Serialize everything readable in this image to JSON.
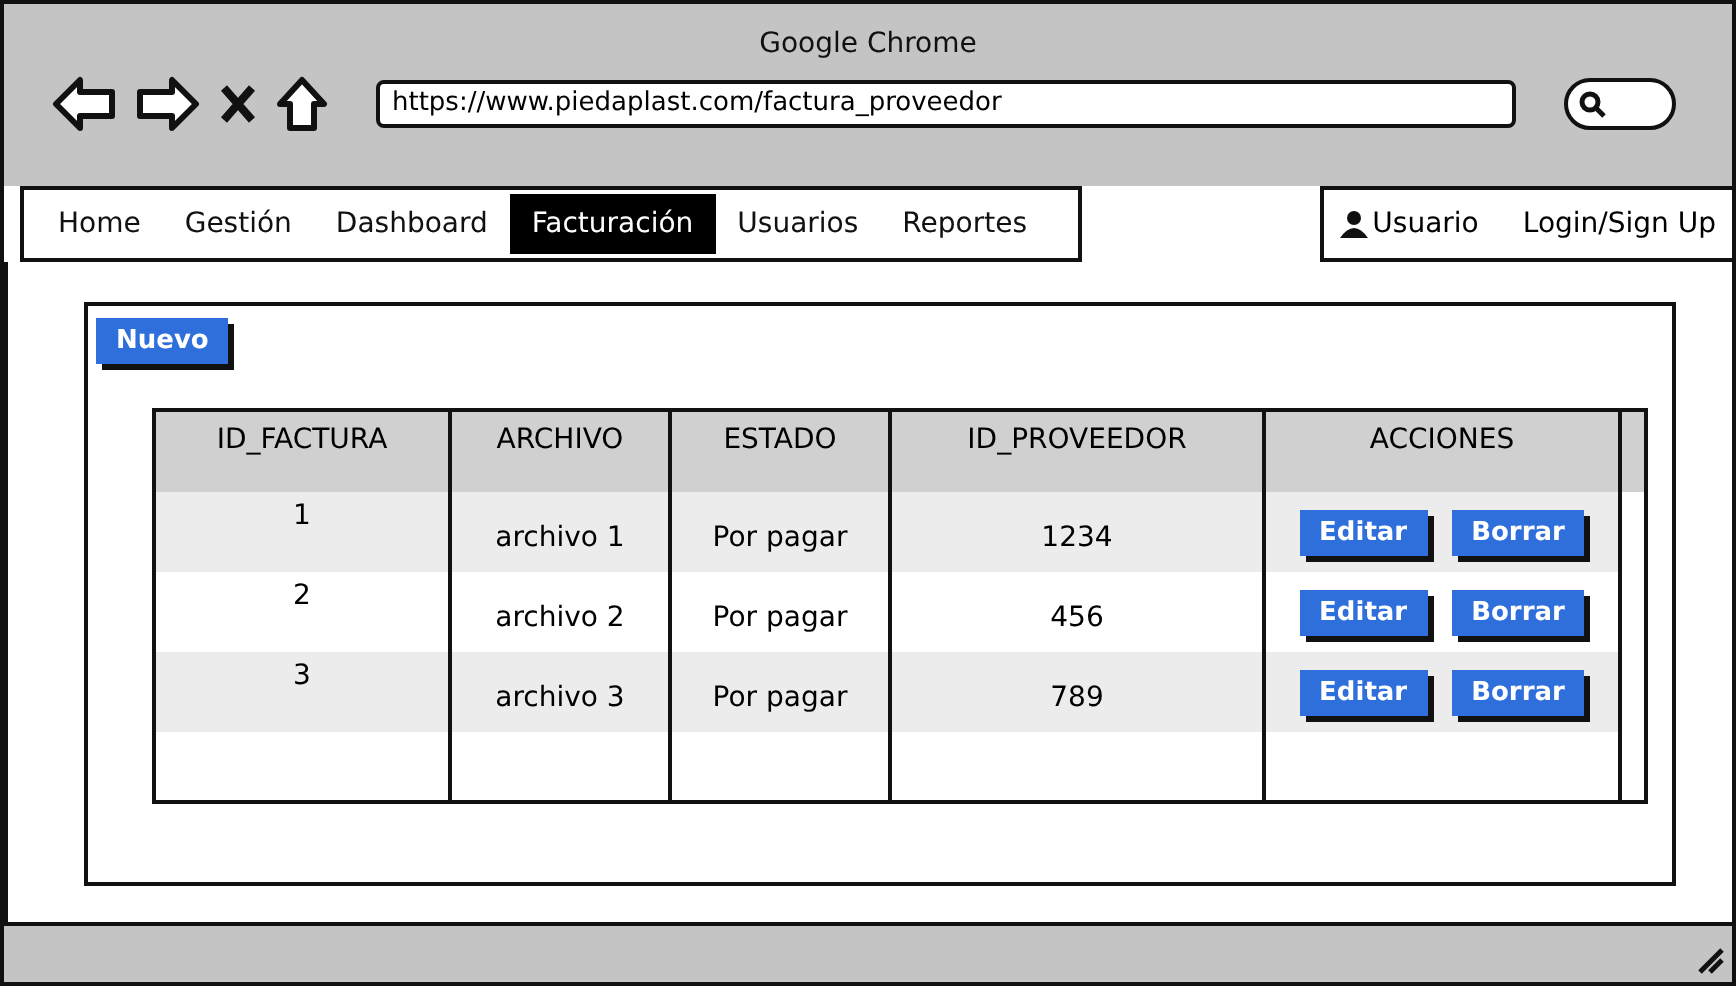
{
  "window": {
    "title": "Google Chrome"
  },
  "address_bar": {
    "value": "https://www.piedaplast.com/factura_proveedor"
  },
  "menu": [
    {
      "label": "Home",
      "selected": false
    },
    {
      "label": "Gestión",
      "selected": false
    },
    {
      "label": "Dashboard",
      "selected": false
    },
    {
      "label": "Facturación",
      "selected": true
    },
    {
      "label": "Usuarios",
      "selected": false
    },
    {
      "label": "Reportes",
      "selected": false
    }
  ],
  "user_menu": {
    "user": "Usuario",
    "login": "Login/Sign Up"
  },
  "new_button": "Nuevo",
  "table": {
    "columns": [
      "ID_FACTURA",
      "ARCHIVO",
      "ESTADO",
      "ID_PROVEEDOR",
      "ACCIONES"
    ],
    "rows": [
      {
        "id": "1",
        "file": "archivo 1",
        "status": "Por pagar",
        "supplier": "1234",
        "actions": [
          "Editar",
          "Borrar"
        ]
      },
      {
        "id": "2",
        "file": "archivo 2",
        "status": "Por pagar",
        "supplier": "456",
        "actions": [
          "Editar",
          "Borrar"
        ]
      },
      {
        "id": "3",
        "file": "archivo 3",
        "status": "Por pagar",
        "supplier": "789",
        "actions": [
          "Editar",
          "Borrar"
        ]
      }
    ]
  }
}
